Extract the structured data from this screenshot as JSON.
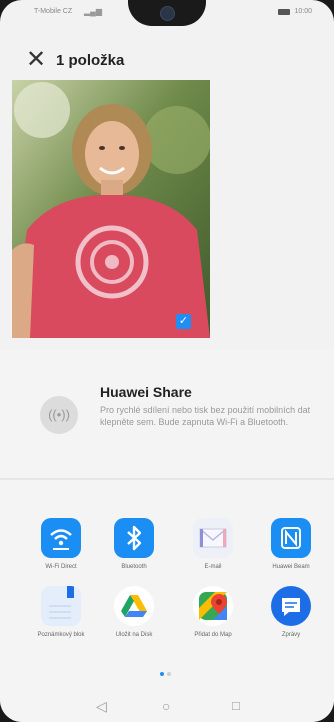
{
  "status": {
    "carrier": "T-Mobile CZ",
    "time": "10:00"
  },
  "header": {
    "title": "1 položka"
  },
  "huawei_share": {
    "title": "Huawei Share",
    "description": "Pro rychlé sdílení nebo tisk bez použití mobilních dat klepněte sem. Bude zapnuta Wi-Fi a Bluetooth."
  },
  "apps": [
    {
      "label": "Wi-Fi Direct",
      "icon": "wifi-direct-icon"
    },
    {
      "label": "Bluetooth",
      "icon": "bluetooth-icon"
    },
    {
      "label": "E-mail",
      "icon": "email-icon"
    },
    {
      "label": "Huawei Beam",
      "icon": "nfc-icon"
    },
    {
      "label": "Poznámkový blok",
      "icon": "notepad-icon"
    },
    {
      "label": "Uložit na Disk",
      "icon": "google-drive-icon"
    },
    {
      "label": "Přidat do Map",
      "icon": "google-maps-icon"
    },
    {
      "label": "Zprávy",
      "icon": "messages-icon"
    }
  ],
  "colors": {
    "accent": "#1f8ff5",
    "photo_shirt": "#d94a5e"
  }
}
